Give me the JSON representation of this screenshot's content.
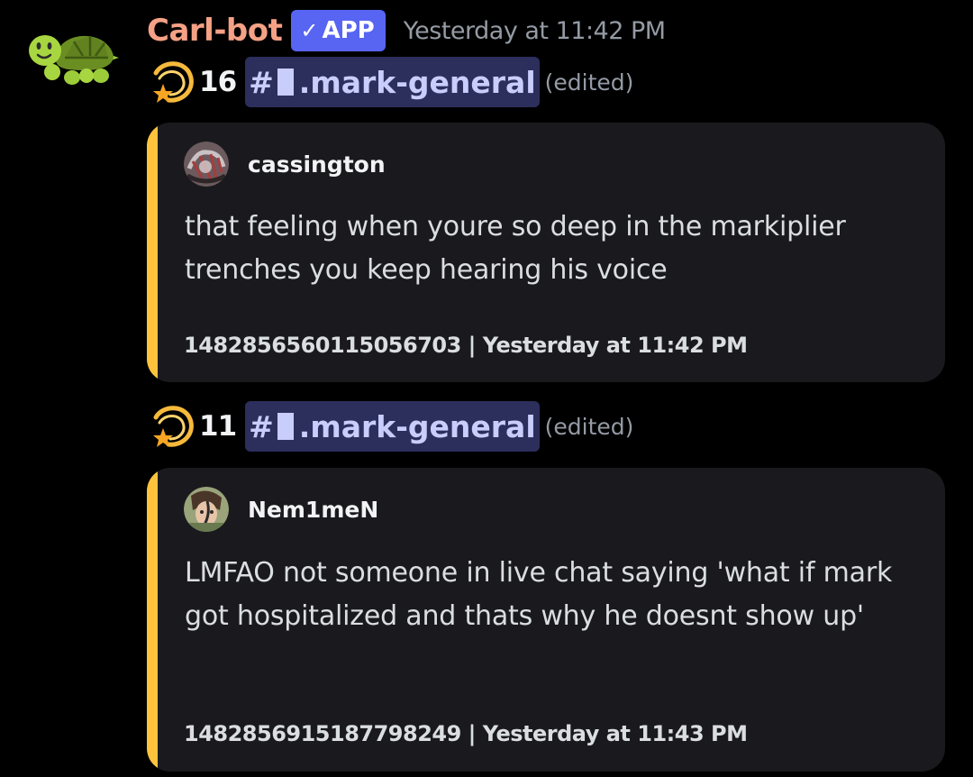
{
  "message": {
    "avatar_icon": "turtle-icon",
    "username": "Carl-bot",
    "app_badge": "APP",
    "badge_icon": "checkmark-icon",
    "timestamp": "Yesterday at 11:42 PM",
    "colors": {
      "username": "#f5a185",
      "badge": "#5865f2",
      "mention_bg": "#2c2e5c",
      "mention_text": "#c9cdfb",
      "embed_bar": "#ffc23d",
      "embed_bg": "#1a1a1e"
    }
  },
  "starboard": [
    {
      "icon": "shooting-star-icon",
      "count": "16",
      "channel_hash": "#",
      "channel_name": ".mark-general",
      "edited": "(edited)",
      "embed": {
        "author_avatar_icon": "user-avatar-icon",
        "author": "cassington",
        "description": "that feeling when youre so deep in the markiplier trenches you keep hearing his voice",
        "footer": "1482856560115056703 | Yesterday at 11:42 PM"
      }
    },
    {
      "icon": "shooting-star-icon",
      "count": "11",
      "channel_hash": "#",
      "channel_name": ".mark-general",
      "edited": "(edited)",
      "embed": {
        "author_avatar_icon": "user-avatar-icon",
        "author": "Nem1meN",
        "description": "LMFAO not someone in live chat saying 'what if mark got hospitalized and thats why he doesnt show up'",
        "footer": "1482856915187798249 | Yesterday at 11:43 PM"
      }
    }
  ]
}
